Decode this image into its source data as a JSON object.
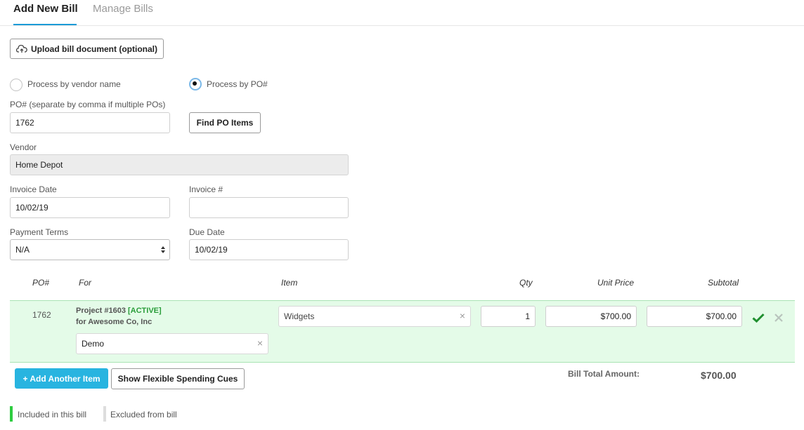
{
  "tabs": [
    {
      "label": "Add New Bill",
      "active": true
    },
    {
      "label": "Manage Bills",
      "active": false
    }
  ],
  "upload_button": "Upload bill document (optional)",
  "process_options": [
    {
      "label": "Process by vendor name",
      "checked": false
    },
    {
      "label": "Process by PO#",
      "checked": true
    }
  ],
  "po": {
    "label": "PO# (separate by comma if multiple POs)",
    "value": "1762",
    "find_button": "Find PO Items"
  },
  "vendor": {
    "label": "Vendor",
    "value": "Home Depot"
  },
  "invoice_date": {
    "label": "Invoice Date",
    "value": "10/02/19"
  },
  "invoice_number": {
    "label": "Invoice #",
    "value": ""
  },
  "payment_terms": {
    "label": "Payment Terms",
    "value": "N/A"
  },
  "due_date": {
    "label": "Due Date",
    "value": "10/02/19"
  },
  "table": {
    "headers": {
      "po": "PO#",
      "for": "For",
      "item": "Item",
      "qty": "Qty",
      "unit_price": "Unit Price",
      "subtotal": "Subtotal"
    },
    "rows": [
      {
        "po": "1762",
        "project": "Project #1603",
        "status": "[ACTIVE]",
        "for_client": "for Awesome Co, Inc",
        "category": "Demo",
        "item": "Widgets",
        "qty": "1",
        "unit_price": "$700.00",
        "subtotal": "$700.00"
      }
    ]
  },
  "add_item_button": "+ Add Another Item",
  "flex_cues_button": "Show Flexible Spending Cues",
  "total": {
    "label": "Bill Total Amount:",
    "value": "$700.00"
  },
  "legend": {
    "included": "Included in this bill",
    "excluded": "Excluded from bill"
  },
  "colors": {
    "accent": "#1a9bd7",
    "primary_button": "#28b4e0",
    "included": "#2ecc40",
    "included_row": "#e4fbe8",
    "excluded": "#dddddd"
  },
  "icons": [
    "upload-cloud-icon",
    "select-arrows-icon",
    "clear-icon",
    "check-icon",
    "remove-icon"
  ]
}
